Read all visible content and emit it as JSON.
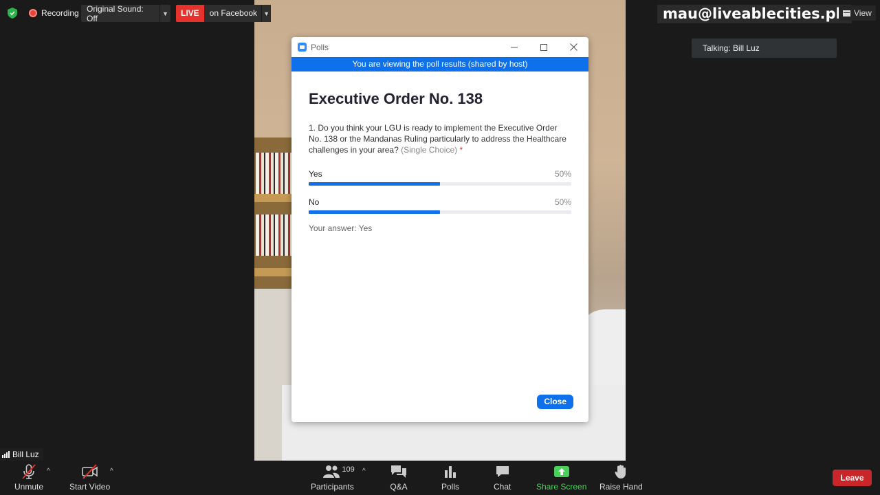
{
  "topbar": {
    "recording_label": "Recording",
    "original_sound_label": "Original Sound: Off",
    "live_badge": "LIVE",
    "live_destination": "on Facebook",
    "email": "mau@liveablecities.ph",
    "view_label": "View",
    "talking": "Talking: Bill Luz"
  },
  "poll_window": {
    "title": "Polls",
    "banner": "You are viewing the poll results (shared by host)",
    "poll_title": "Executive Order No. 138",
    "question_text": "1. Do you think your LGU is ready to implement the Executive Order No. 138 or the Mandanas Ruling particularly to address the Healthcare challenges in your area?",
    "question_type": "(Single Choice)",
    "required_mark": "*",
    "options": [
      {
        "label": "Yes",
        "percent_text": "50%",
        "fraction": 0.5
      },
      {
        "label": "No",
        "percent_text": "50%",
        "fraction": 0.5
      }
    ],
    "your_answer": "Your answer: Yes",
    "close_label": "Close"
  },
  "video": {
    "participant_name": "Bill Luz"
  },
  "toolbar": {
    "unmute": "Unmute",
    "start_video": "Start Video",
    "participants": "Participants",
    "participant_count": "109",
    "qa": "Q&A",
    "polls": "Polls",
    "chat": "Chat",
    "share_screen": "Share Screen",
    "raise_hand": "Raise Hand",
    "leave": "Leave"
  },
  "colors": {
    "accent_blue": "#0e71eb",
    "live_red": "#e5322d",
    "share_green": "#4bcf5c",
    "leave_red": "#c9262a"
  }
}
